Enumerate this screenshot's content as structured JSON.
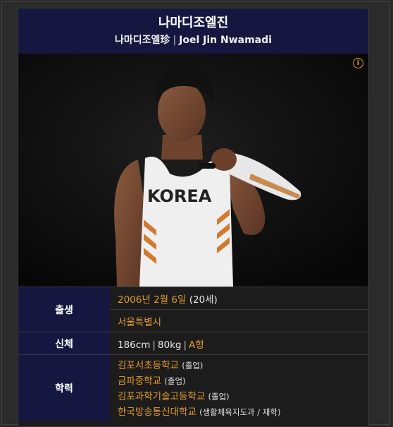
{
  "header": {
    "title": "나마디조엘진",
    "native_name": "나마디조엘珍",
    "english_name": "Joel Jin Nwamadi"
  },
  "photo": {
    "shirt_text": "KOREA",
    "info_icon": "info-icon"
  },
  "rows": {
    "birth": {
      "label": "출생",
      "date": "2006년 2월 6일",
      "age": "(20세)",
      "place": "서울특별시"
    },
    "body": {
      "label": "신체",
      "height": "186cm",
      "weight": "80kg",
      "blood": "A형"
    },
    "education": {
      "label": "학력",
      "schools": [
        {
          "name": "김포서초등학교",
          "status": "(졸업)"
        },
        {
          "name": "금파중학교",
          "status": "(졸업)"
        },
        {
          "name": "김포과학기술고등학교",
          "status": "(졸업)"
        },
        {
          "name": "한국방송통신대학교",
          "status": "(생활체육지도과 / 재학)"
        }
      ]
    }
  },
  "colors": {
    "header_bg": "#151740",
    "link": "#e39a2c",
    "panel_bg": "#1c1c1c"
  }
}
